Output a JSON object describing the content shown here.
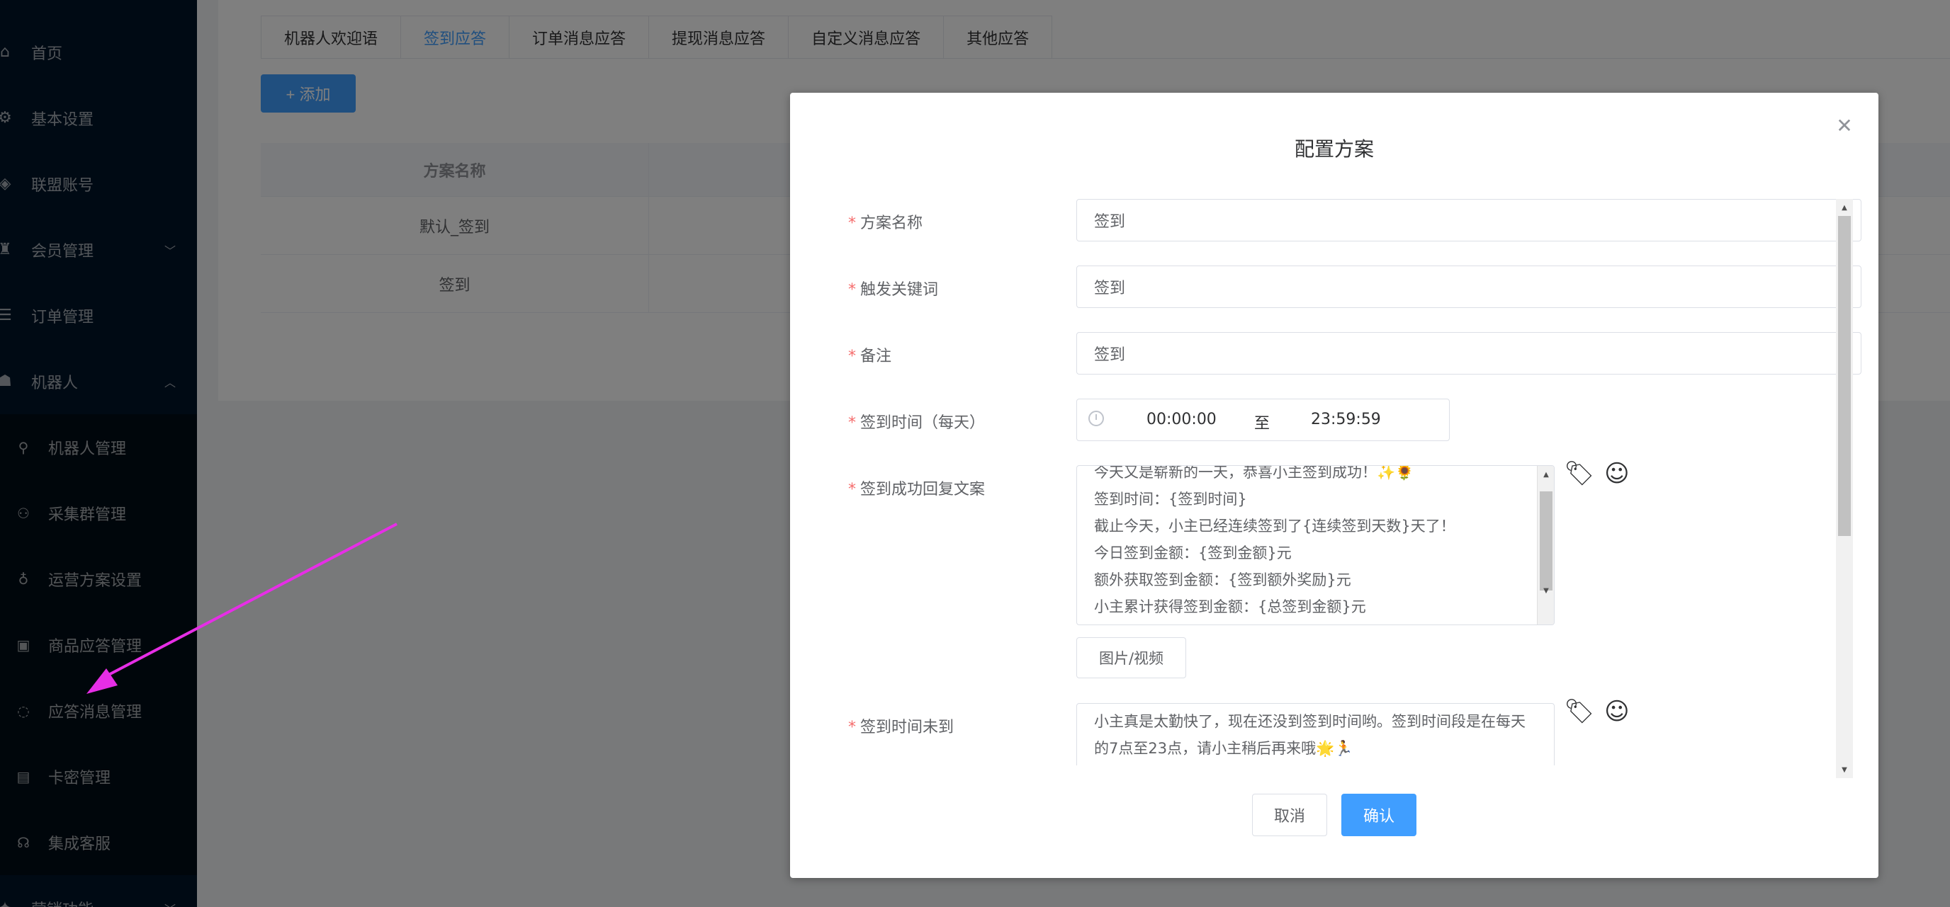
{
  "sidebar": {
    "items": [
      {
        "label": "首页",
        "icon": "home-icon"
      },
      {
        "label": "基本设置",
        "icon": "settings-icon"
      },
      {
        "label": "联盟账号",
        "icon": "account-icon"
      },
      {
        "label": "会员管理",
        "icon": "member-icon"
      },
      {
        "label": "订单管理",
        "icon": "order-icon"
      },
      {
        "label": "机器人",
        "icon": "robot-icon"
      }
    ],
    "sub_items": [
      {
        "label": "机器人管理",
        "icon": "robot-manage-icon"
      },
      {
        "label": "采集群管理",
        "icon": "group-icon"
      },
      {
        "label": "运营方案设置",
        "icon": "bulb-icon"
      },
      {
        "label": "商品应答管理",
        "icon": "goods-icon"
      },
      {
        "label": "应答消息管理",
        "icon": "message-icon"
      },
      {
        "label": "卡密管理",
        "icon": "card-icon"
      },
      {
        "label": "集成客服",
        "icon": "headset-icon"
      }
    ],
    "bottom_item": {
      "label": "营销功能"
    }
  },
  "tabs": [
    "机器人欢迎语",
    "签到应答",
    "订单消息应答",
    "提现消息应答",
    "自定义消息应答",
    "其他应答"
  ],
  "add_button": "+ 添加",
  "table": {
    "header": "方案名称",
    "rows": [
      "默认_签到",
      "签到"
    ]
  },
  "dialog": {
    "title": "配置方案",
    "fields": {
      "name_label": "方案名称",
      "name_value": "签到",
      "keyword_label": "触发关键词",
      "keyword_value": "签到",
      "remark_label": "备注",
      "remark_value": "签到",
      "time_label": "签到时间（每天）",
      "time_start": "00:00:00",
      "time_sep": "至",
      "time_end": "23:59:59",
      "success_label": "签到成功回复文案",
      "success_lines": [
        "今天又是崭新的一天，恭喜小主签到成功！✨🌻",
        "签到时间：{签到时间}",
        "截止今天，小主已经连续签到了{连续签到天数}天了！",
        "今日签到金额：{签到金额}元",
        "额外获取签到金额：{签到额外奖励}元",
        "小主累计获得签到金额：{总签到金额}元"
      ],
      "media_button": "图片/视频",
      "not_time_label": "签到时间未到",
      "not_time_lines": [
        "小主真是太勤快了，现在还没到签到时间哟。签到时间段是在每天",
        "的7点至23点，请小主稍后再来哦🌟🏃"
      ]
    },
    "cancel": "取消",
    "confirm": "确认"
  }
}
